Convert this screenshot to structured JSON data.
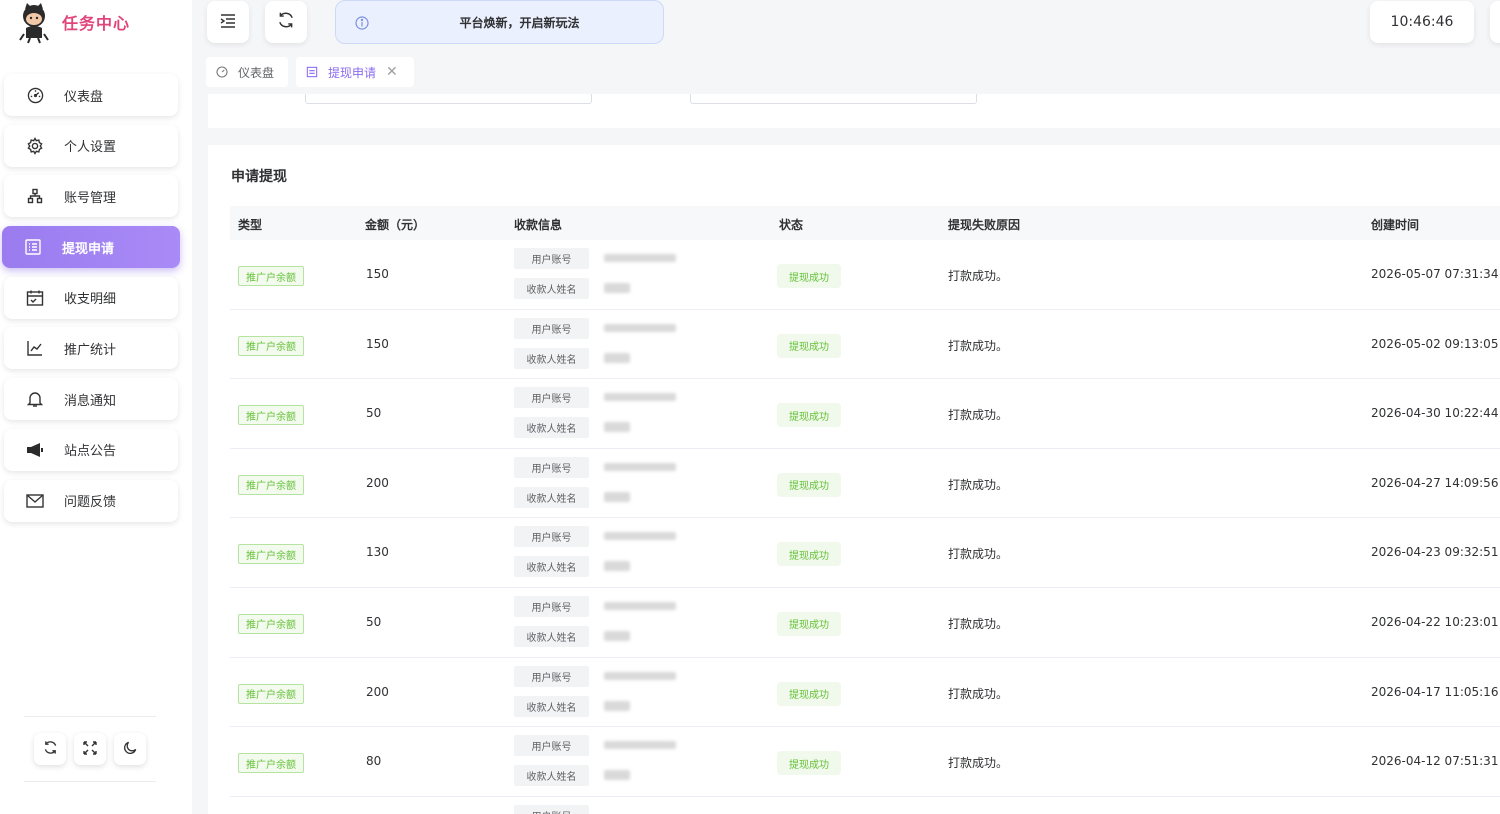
{
  "app": {
    "title": "任务中心"
  },
  "sidebar": {
    "items": [
      {
        "label": "仪表盘",
        "icon": "dashboard-icon",
        "active": false
      },
      {
        "label": "个人设置",
        "icon": "gear-icon",
        "active": false
      },
      {
        "label": "账号管理",
        "icon": "sitemap-icon",
        "active": false
      },
      {
        "label": "提现申请",
        "icon": "list-icon",
        "active": true
      },
      {
        "label": "收支明细",
        "icon": "calendar-icon",
        "active": false
      },
      {
        "label": "推广统计",
        "icon": "line-chart-icon",
        "active": false
      },
      {
        "label": "消息通知",
        "icon": "bell-icon",
        "active": false
      },
      {
        "label": "站点公告",
        "icon": "megaphone-icon",
        "active": false
      },
      {
        "label": "问题反馈",
        "icon": "mail-icon",
        "active": false
      }
    ],
    "tools": [
      "refresh-icon",
      "fullscreen-icon",
      "moon-icon"
    ]
  },
  "header": {
    "notice": "平台焕新，开启新玩法",
    "clock": "10:46:46"
  },
  "tabs": [
    {
      "label": "仪表盘",
      "active": false
    },
    {
      "label": "提现申请",
      "active": true
    }
  ],
  "card": {
    "title": "申请提现",
    "columns": [
      "类型",
      "金额（元）",
      "收款信息",
      "状态",
      "提现失败原因",
      "创建时间"
    ],
    "payinfo_labels": {
      "account": "用户账号",
      "name": "收款人姓名"
    },
    "rows": [
      {
        "type": "推广户余额",
        "amount": "150",
        "status": "提现成功",
        "reason": "打款成功。",
        "time": "2026-05-07 07:31:34"
      },
      {
        "type": "推广户余额",
        "amount": "150",
        "status": "提现成功",
        "reason": "打款成功。",
        "time": "2026-05-02 09:13:05"
      },
      {
        "type": "推广户余额",
        "amount": "50",
        "status": "提现成功",
        "reason": "打款成功。",
        "time": "2026-04-30 10:22:44"
      },
      {
        "type": "推广户余额",
        "amount": "200",
        "status": "提现成功",
        "reason": "打款成功。",
        "time": "2026-04-27 14:09:56"
      },
      {
        "type": "推广户余额",
        "amount": "130",
        "status": "提现成功",
        "reason": "打款成功。",
        "time": "2026-04-23 09:32:51"
      },
      {
        "type": "推广户余额",
        "amount": "50",
        "status": "提现成功",
        "reason": "打款成功。",
        "time": "2026-04-22 10:23:01"
      },
      {
        "type": "推广户余额",
        "amount": "200",
        "status": "提现成功",
        "reason": "打款成功。",
        "time": "2026-04-17 11:05:16"
      },
      {
        "type": "推广户余额",
        "amount": "80",
        "status": "提现成功",
        "reason": "打款成功。",
        "time": "2026-04-12 07:51:31"
      }
    ]
  },
  "colors": {
    "brand": "#e0457b",
    "accent": "#9b7cf0",
    "success": "#67c23a"
  }
}
